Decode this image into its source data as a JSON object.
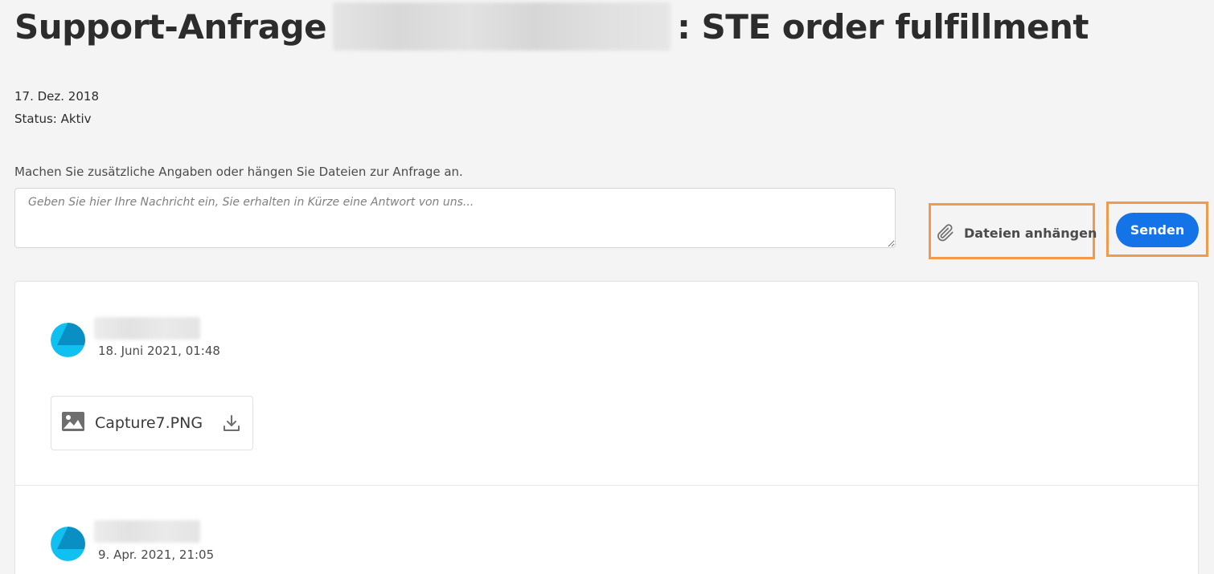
{
  "header": {
    "title_prefix": "Support-Anfrage",
    "title_suffix": ": STE order fulfillment"
  },
  "meta": {
    "date": "17. Dez. 2018",
    "status": "Status: Aktiv"
  },
  "compose": {
    "prompt": "Machen Sie zusätzliche Angaben oder hängen Sie Dateien zur Anfrage an.",
    "placeholder": "Geben Sie hier Ihre Nachricht ein, Sie erhalten in Kürze eine Antwort von uns...",
    "attach_label": "Dateien anhängen",
    "attach_icon": "paperclip-icon",
    "send_label": "Senden"
  },
  "colors": {
    "accent": "#1473e6",
    "highlight": "#f29a4b",
    "avatar": "#0fc0f0"
  },
  "thread": {
    "entries": [
      {
        "date": "18. Juni 2021, 01:48",
        "attachments": [
          {
            "name": "Capture7.PNG",
            "icon": "image-icon",
            "action_icon": "download-icon"
          }
        ]
      },
      {
        "date": "9. Apr. 2021, 21:05"
      }
    ]
  }
}
